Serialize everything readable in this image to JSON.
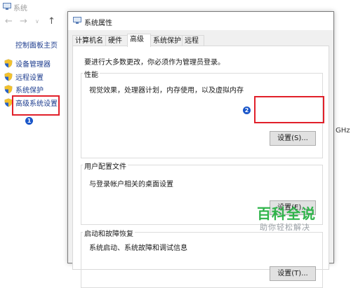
{
  "background_window": {
    "title": "系统",
    "control_panel_home": "控制面板主页",
    "sidebar_links": [
      {
        "label": "设备管理器"
      },
      {
        "label": "远程设置"
      },
      {
        "label": "系统保护"
      },
      {
        "label": "高级系统设置"
      }
    ],
    "right_clip_text": "GHz"
  },
  "dialog": {
    "title": "系统属性",
    "tabs": [
      {
        "label": "计算机名",
        "active": false
      },
      {
        "label": "硬件",
        "active": false
      },
      {
        "label": "高级",
        "active": true
      },
      {
        "label": "系统保护",
        "active": false
      },
      {
        "label": "远程",
        "active": false
      }
    ],
    "admin_note": "要进行大多数更改，你必须作为管理员登录。",
    "groups": [
      {
        "title": "性能",
        "description": "视觉效果，处理器计划，内存使用，以及虚拟内存",
        "button": "设置(S)..."
      },
      {
        "title": "用户配置文件",
        "description": "与登录帐户相关的桌面设置",
        "button": "设置(E)..."
      },
      {
        "title": "启动和故障恢复",
        "description": "系统启动、系统故障和调试信息",
        "button": "设置(T)..."
      }
    ]
  },
  "annotations": {
    "step1": "1",
    "step2": "2",
    "highlight_color": "#e1202a",
    "badge_color": "#1a56c9"
  },
  "watermark": {
    "title": "百科全说",
    "subtitle": "助你轻松解决"
  }
}
